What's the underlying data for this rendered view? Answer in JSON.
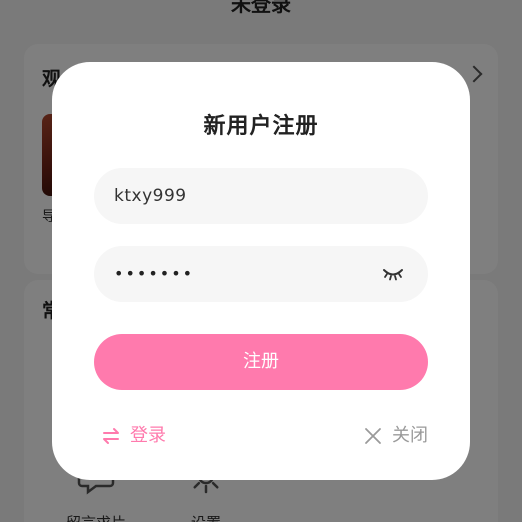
{
  "background": {
    "page_title": "未登录",
    "section1_heading": "观",
    "section1_item_caption": "导",
    "section2_heading": "常",
    "tools": [
      {
        "label": "留言求片",
        "icon": "chat-bubble-icon"
      },
      {
        "label": "设置",
        "icon": "gear-icon"
      }
    ]
  },
  "modal": {
    "title": "新用户注册",
    "username": {
      "value": "ktxy999",
      "icon": "none"
    },
    "password": {
      "value": "•••••••",
      "icon": "eye-closed-icon"
    },
    "register_label": "注册",
    "login_label": "登录",
    "login_icon": "swap-icon",
    "close_label": "关闭",
    "close_icon": "close-icon"
  },
  "colors": {
    "accent": "#ff7aad",
    "overlay": "rgba(0,0,0,0.5)",
    "field_bg": "#f6f6f6",
    "muted_text": "#9a9a9a"
  }
}
